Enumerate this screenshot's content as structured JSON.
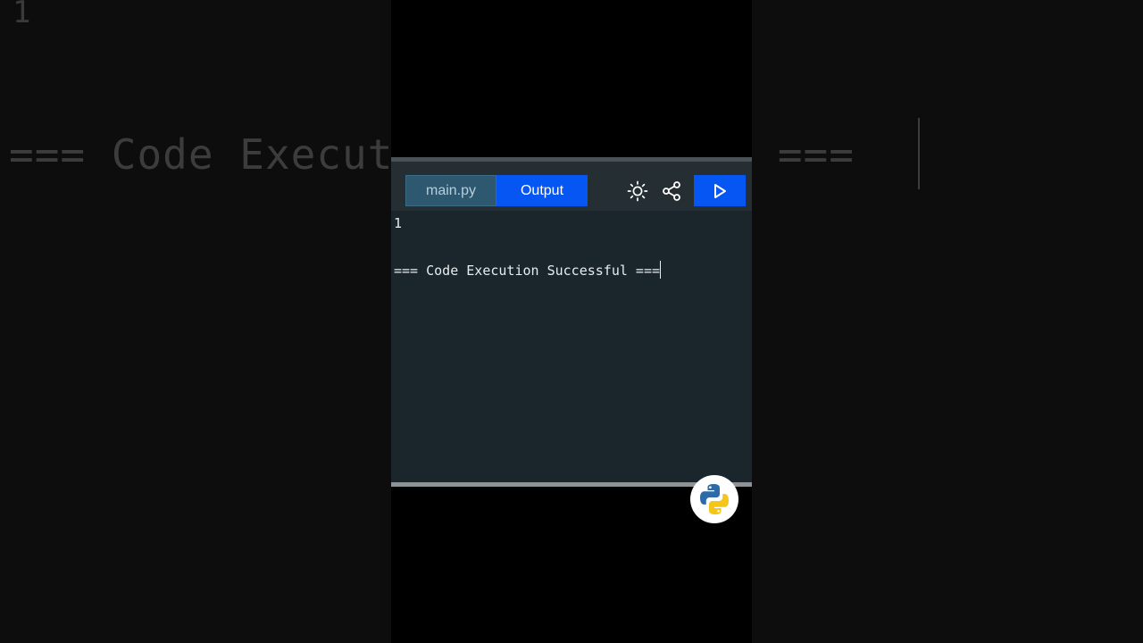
{
  "background": {
    "line_number": "1",
    "success_text": "=== Code Execution Successful ==="
  },
  "toolbar": {
    "tabs": [
      {
        "label": "main.py",
        "active": false
      },
      {
        "label": "Output",
        "active": true
      }
    ],
    "icons": {
      "theme": "sun-icon",
      "share": "share-icon",
      "run": "play-icon"
    },
    "colors": {
      "accent": "#0556f3",
      "panel": "#1b262c",
      "toolbar": "#252f33"
    }
  },
  "output": {
    "lines": [
      "1",
      "=== Code Execution Successful ==="
    ]
  },
  "badge": {
    "icon": "python-logo-icon"
  }
}
